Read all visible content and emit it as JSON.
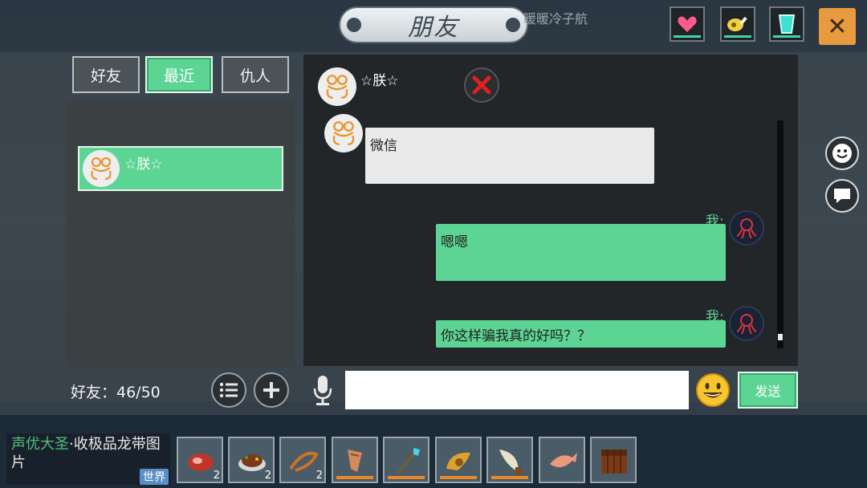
{
  "header": {
    "title": "朋友",
    "background_label": "暖暖冷子航"
  },
  "top_buttons": [
    {
      "name": "heart-icon",
      "color": "#ff5b8a"
    },
    {
      "name": "meat-icon",
      "color": "#f0d23c"
    },
    {
      "name": "water-cup-icon",
      "color": "#3fe0d0"
    }
  ],
  "close_label": "✕",
  "tabs": [
    {
      "label": "好友",
      "active": false
    },
    {
      "label": "最近",
      "active": true
    },
    {
      "label": "仇人",
      "active": false
    }
  ],
  "friends": [
    {
      "name": "☆朕☆"
    }
  ],
  "friend_count": "好友：46/50",
  "chat": {
    "header_name": "☆朕☆",
    "messages": [
      {
        "from": "them",
        "text": "微信"
      },
      {
        "from": "me",
        "sender_label": "我:",
        "text": "嗯嗯"
      },
      {
        "from": "me",
        "sender_label": "我:",
        "text": "你这样骗我真的好吗？？"
      }
    ]
  },
  "input": {
    "value": "",
    "placeholder": ""
  },
  "send_label": "发送",
  "world_chat": {
    "speaker": "声优大圣",
    "text": "·收极品龙带图片",
    "badge": "世界"
  },
  "hotbar": [
    {
      "item": "raw-meat-icon",
      "count": "2"
    },
    {
      "item": "cooked-steak-icon",
      "count": "2"
    },
    {
      "item": "rope-icon",
      "count": "2"
    },
    {
      "item": "bone-club-icon",
      "count": ""
    },
    {
      "item": "spear-icon",
      "count": ""
    },
    {
      "item": "horn-icon",
      "count": ""
    },
    {
      "item": "tooth-blade-icon",
      "count": ""
    },
    {
      "item": "fish-icon",
      "count": ""
    },
    {
      "item": "chest-icon",
      "count": ""
    }
  ],
  "colors": {
    "accent": "#5cd494",
    "close": "#e89a3e",
    "panel": "#232628",
    "me_label": "#5cd494"
  }
}
